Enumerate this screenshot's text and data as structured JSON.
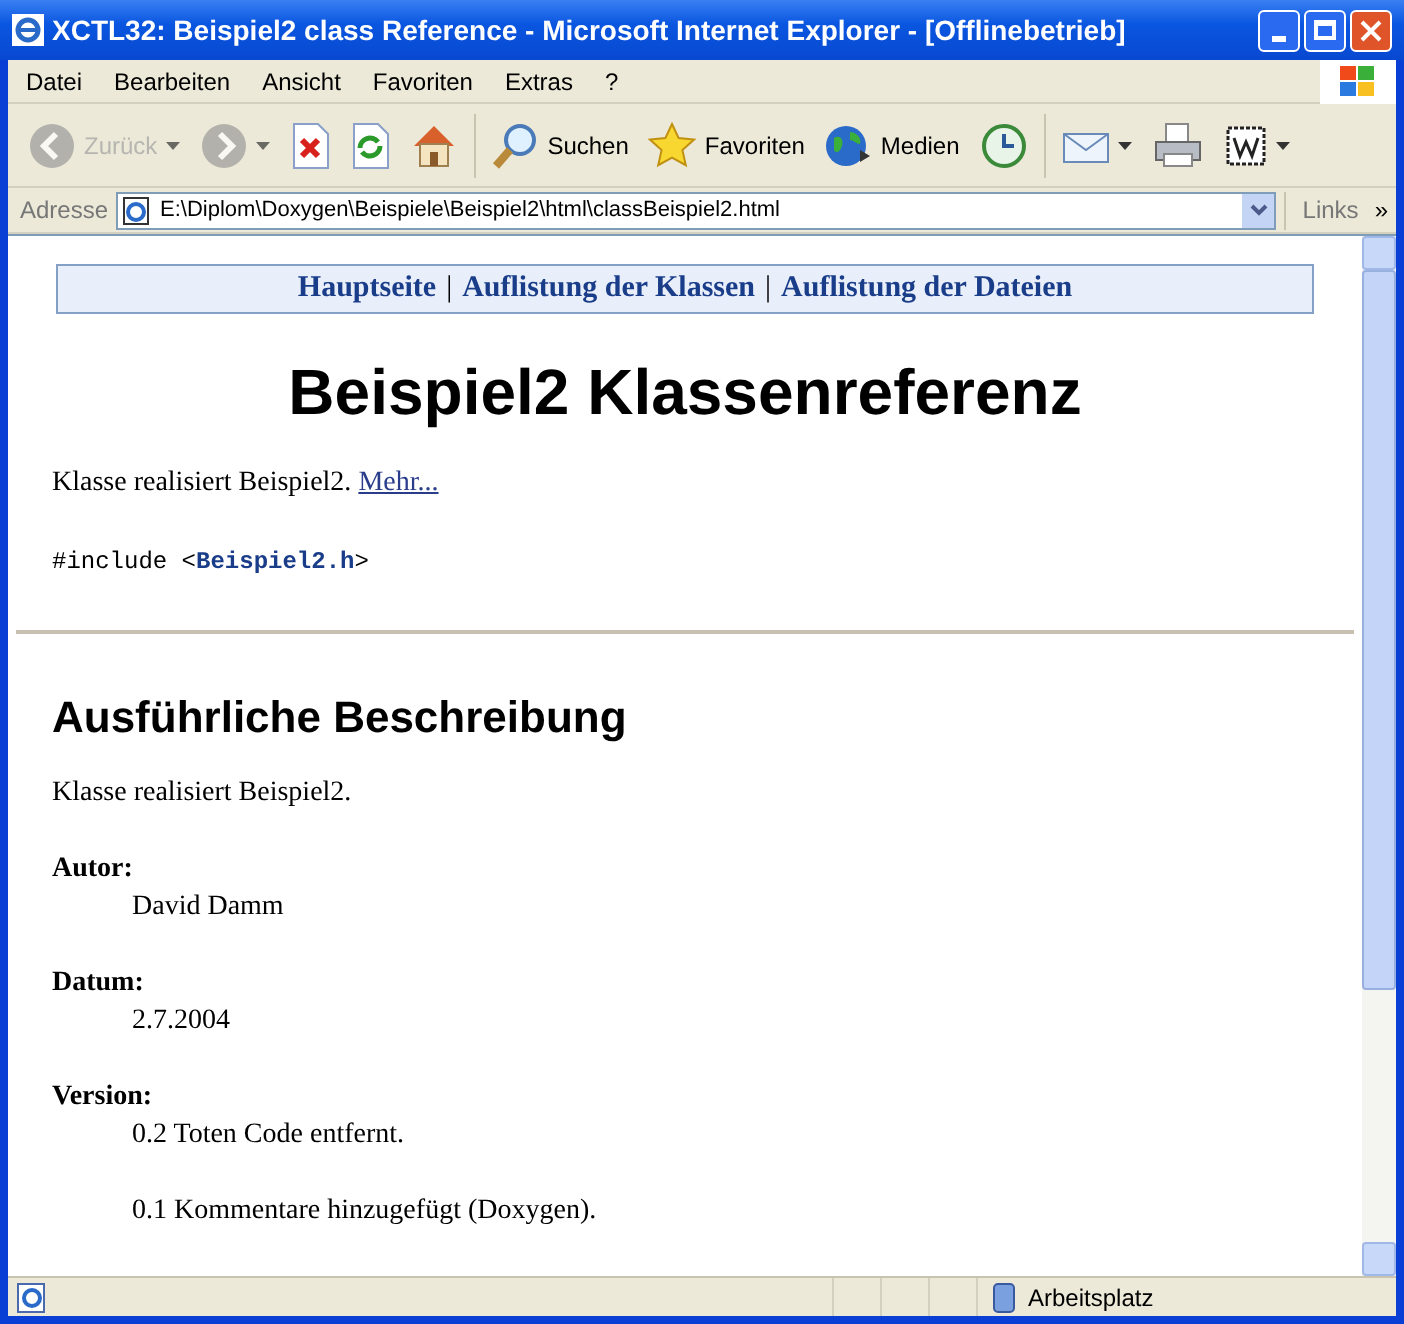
{
  "window": {
    "title": "XCTL32: Beispiel2 class Reference - Microsoft Internet Explorer - [Offlinebetrieb]"
  },
  "menu": [
    "Datei",
    "Bearbeiten",
    "Ansicht",
    "Favoriten",
    "Extras",
    "?"
  ],
  "toolbar": [
    {
      "kind": "back",
      "label": "Zurück",
      "disabled": true
    },
    {
      "kind": "forward",
      "disabled": true
    },
    {
      "kind": "stop",
      "disabled": false
    },
    {
      "kind": "refresh",
      "disabled": false
    },
    {
      "kind": "home",
      "disabled": false
    },
    {
      "kind": "search",
      "label": "Suchen",
      "disabled": false
    },
    {
      "kind": "favorites",
      "label": "Favoriten",
      "disabled": false
    },
    {
      "kind": "media",
      "label": "Medien",
      "disabled": false
    },
    {
      "kind": "history",
      "disabled": false
    },
    {
      "kind": "mail",
      "disabled": false
    },
    {
      "kind": "print",
      "disabled": false
    },
    {
      "kind": "edit",
      "disabled": false
    }
  ],
  "address": {
    "label": "Adresse",
    "value": "E:\\Diplom\\Doxygen\\Beispiele\\Beispiel2\\html\\classBeispiel2.html",
    "links": "Links",
    "more": "»"
  },
  "page": {
    "nav": [
      "Hauptseite",
      "Auflistung der Klassen",
      "Auflistung der Dateien"
    ],
    "nav_separator": "|",
    "title": "Beispiel2 Klassenreferenz",
    "brief": "Klasse realisiert Beispiel2.",
    "more_link": "Mehr...",
    "include": {
      "prefix": "#include <",
      "file": "Beispiel2.h",
      "suffix": ">"
    },
    "section_title": "Ausführliche Beschreibung",
    "description": "Klasse realisiert Beispiel2.",
    "fields": [
      {
        "term": "Autor:",
        "values": [
          "David Damm"
        ]
      },
      {
        "term": "Datum:",
        "values": [
          "2.7.2004"
        ]
      },
      {
        "term": "Version:",
        "values": [
          "0.2 Toten Code entfernt.",
          "0.1 Kommentare hinzugefügt (Doxygen)."
        ]
      }
    ]
  },
  "status_bar": {
    "zone": "Arbeitsplatz"
  }
}
